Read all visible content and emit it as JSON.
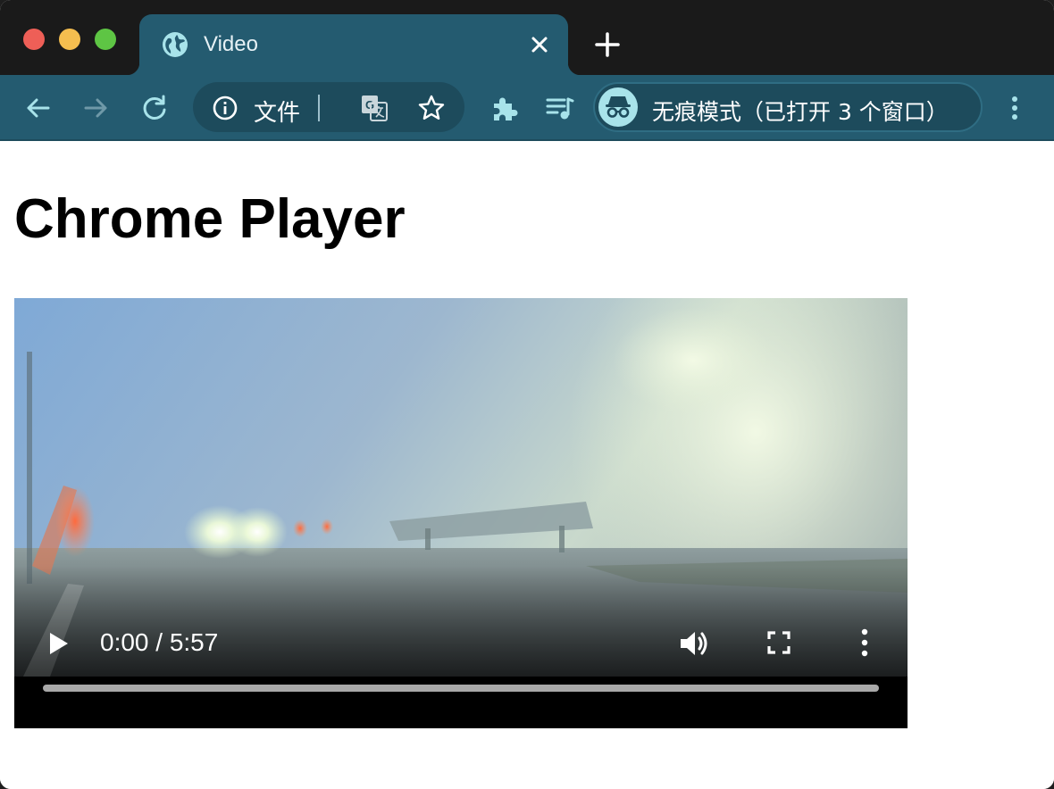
{
  "window": {
    "tab": {
      "title": "Video",
      "favicon": "globe-icon",
      "close_icon": "close-icon"
    },
    "new_tab_icon": "plus-icon"
  },
  "toolbar": {
    "back_icon": "arrow-left-icon",
    "forward_icon": "arrow-right-icon",
    "reload_icon": "reload-icon",
    "omnibox": {
      "security_icon": "info-icon",
      "text": "文件",
      "translate_icon": "translate-icon",
      "bookmark_icon": "star-icon"
    },
    "extensions_icon": "puzzle-icon",
    "media_icon": "media-queue-icon",
    "incognito": {
      "label": "无痕模式（已打开 3 个窗口）",
      "icon": "incognito-icon"
    },
    "menu_icon": "kebab-icon"
  },
  "page": {
    "title": "Chrome Player",
    "video": {
      "time": "0:00 / 5:57",
      "progress": 0,
      "play_icon": "play-icon",
      "volume_icon": "volume-icon",
      "fullscreen_icon": "fullscreen-icon",
      "more_icon": "more-vertical-icon"
    }
  },
  "colors": {
    "tab_strip": "#1a1a1a",
    "toolbar": "#245b70",
    "omnibox": "#1d4b5c",
    "accent": "#a8e3ea"
  }
}
